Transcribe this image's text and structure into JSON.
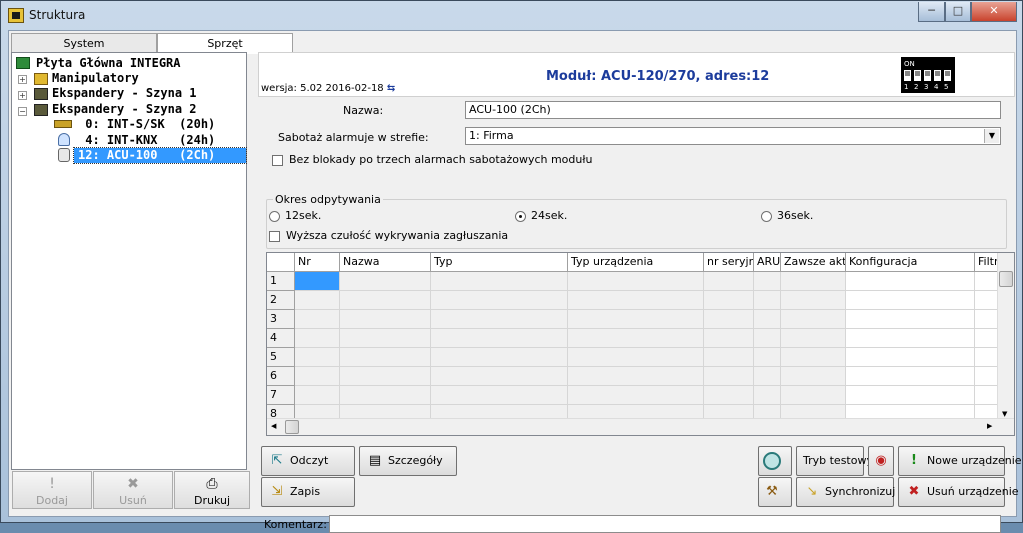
{
  "window": {
    "title": "Struktura"
  },
  "tabs": [
    {
      "label": "System"
    },
    {
      "label": "Sprzęt"
    }
  ],
  "tree": {
    "root": "Płyta Główna INTEGRA",
    "nodes": [
      {
        "label": "Manipulatory"
      },
      {
        "label": "Ekspandery - Szyna 1"
      },
      {
        "label": "Ekspandery - Szyna 2"
      },
      {
        "label": " 0: INT-S/SK  (20h)"
      },
      {
        "label": " 4: INT-KNX   (24h)"
      },
      {
        "label": "12: ACU-100   (2Ch)"
      }
    ]
  },
  "left_buttons": {
    "add": "Dodaj",
    "remove": "Usuń",
    "print": "Drukuj"
  },
  "module": {
    "title": "Moduł: ACU-120/270, adres:12",
    "version": "wersja: 5.02 2016-02-18",
    "dip_on": "ON",
    "dip_numbers": [
      "1",
      "2",
      "3",
      "4",
      "5"
    ]
  },
  "form": {
    "name_label": "Nazwa:",
    "name_value": "ACU-100   (2Ch)",
    "tamper_label": "Sabotaż alarmuje w strefie:",
    "tamper_value": "1: Firma",
    "noblock_label": "Bez blokady po trzech alarmach sabotażowych modułu",
    "poll_title": "Okres odpytywania",
    "poll_options": [
      "12sek.",
      "24sek.",
      "36sek."
    ],
    "poll_selected": "24sek.",
    "jam_label": "Wyższa czułość wykrywania zagłuszania"
  },
  "grid": {
    "columns": [
      "Nr",
      "Nazwa",
      "Typ",
      "Typ urządzenia",
      "nr seryjny",
      "ARU",
      "Zawsze akt.",
      "Konfiguracja",
      "Filtr"
    ],
    "rows": [
      "1",
      "2",
      "3",
      "4",
      "5",
      "6",
      "7",
      "8"
    ]
  },
  "buttons": {
    "read": "Odczyt",
    "details": "Szczegóły",
    "write": "Zapis",
    "test_mode": "Tryb testowy",
    "new_device": "Nowe urządzenie",
    "sync": "Synchronizuj",
    "remove_device": "Usuń urządzenie"
  },
  "comment_label": "Komentarz:",
  "colors": {
    "accent": "#1c3c9c",
    "selection": "#3399ff",
    "remove": "#c02020"
  }
}
